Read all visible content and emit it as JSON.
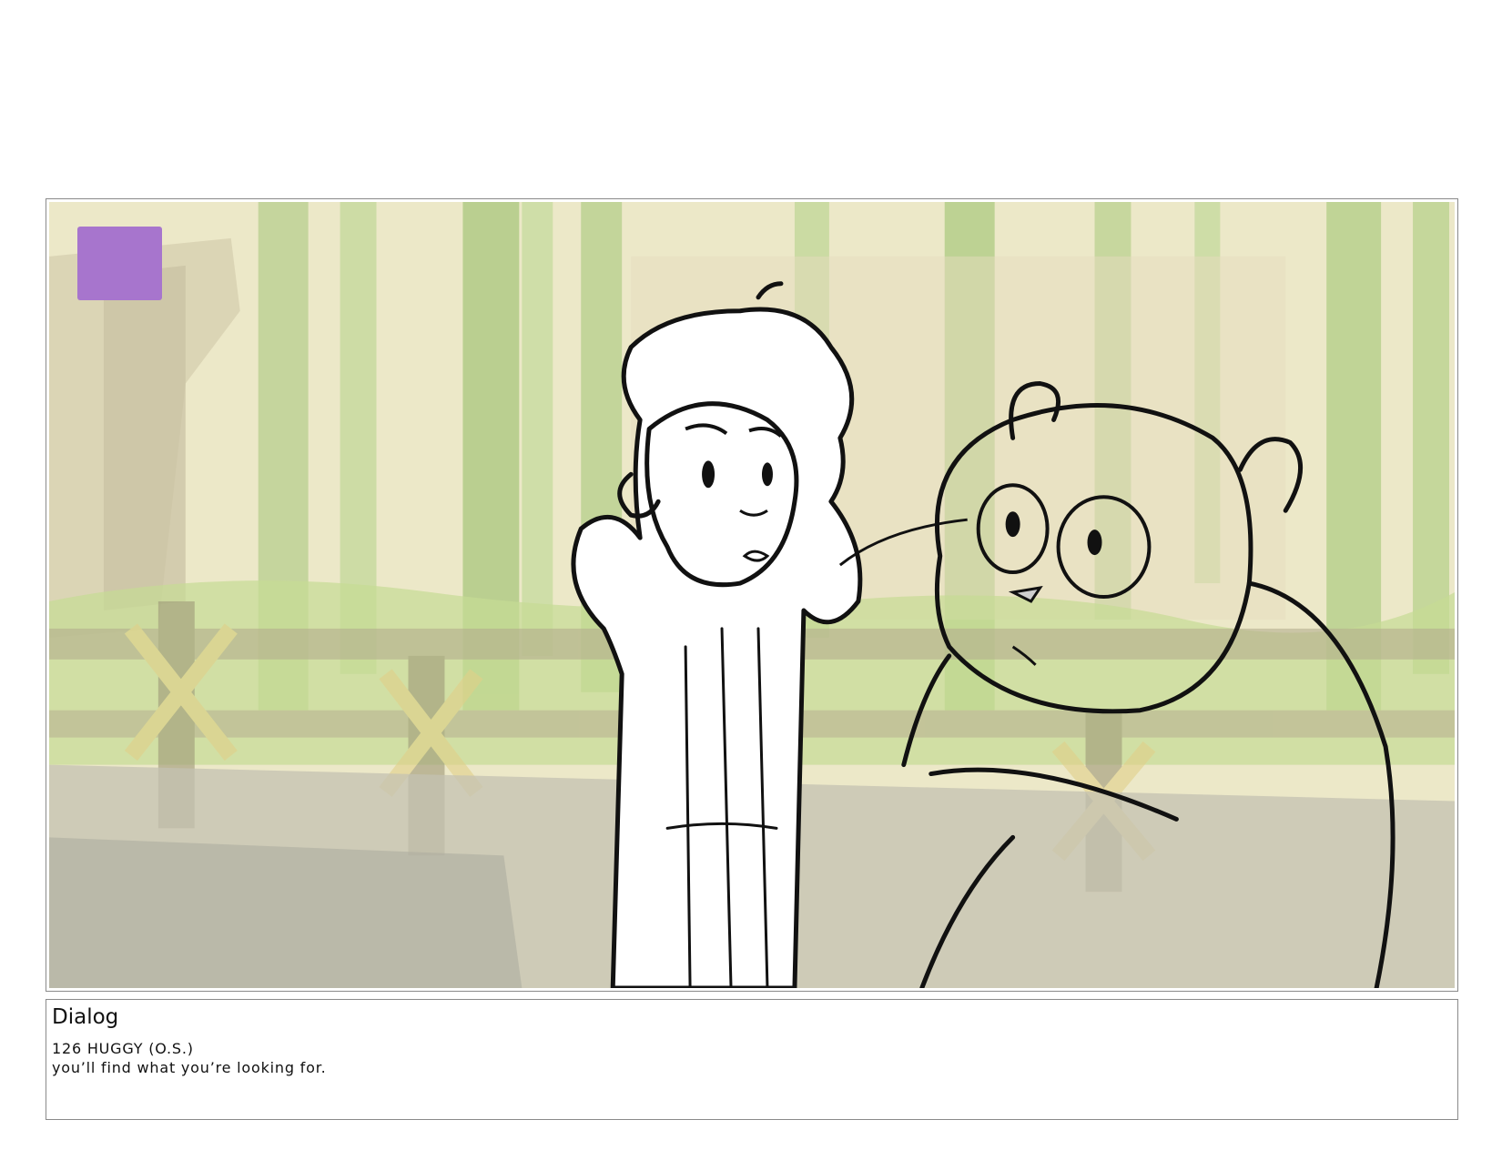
{
  "panel": {
    "marker_color": "#a775cd"
  },
  "dialog": {
    "heading": "Dialog",
    "speaker": "126 HUGGY (O.S.)",
    "line": "you’ll find what you’re looking for."
  }
}
